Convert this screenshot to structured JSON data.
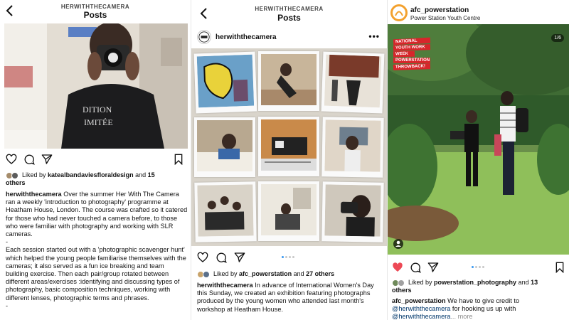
{
  "panel1": {
    "header_username": "HERWITHTHECAMERA",
    "header_title": "Posts",
    "likes": {
      "prefix": "Liked by",
      "name": "katealbandaviesfloraldesign",
      "and": "and",
      "count": "15",
      "suffix": "others"
    },
    "caption": {
      "username": "herwiththecamera",
      "text1": "Over the summer Her With The Camera ran a weekly 'introduction to photography' programme at Heatham House, London. The course was crafted so it catered for those who had never touched a camera before, to those who were familiar with photography and working with SLR cameras.",
      "dot": "-",
      "text2": "Each session started out with a 'photographic scavenger hunt' which helped the young people familiarise themselves with the cameras; it also served as a fun ice breaking and team building exercise. Then each pair/group rotated between different areas/exercises :identifying and discussing types of photography, basic composition techniques, working with different lenses, photographic terms and phrases.",
      "dot2": "-"
    }
  },
  "panel2": {
    "header_username": "HERWITHTHECAMERA",
    "header_title": "Posts",
    "account": "herwiththecamera",
    "likes": {
      "prefix": "Liked by",
      "name": "afc_powerstation",
      "and": "and",
      "count": "27 others"
    },
    "caption": {
      "username": "herwiththecamera",
      "text": "In advance of International Women's Day this Sunday, we created an exhibition featuring photographs produced by the young women who attended last month's workshop at Heatham House."
    }
  },
  "panel3": {
    "account": "afc_powerstation",
    "location": "Power Station Youth Centre",
    "carousel_count": "1/6",
    "sign_lines": [
      "NATIONAL",
      "YOUTH WORK",
      "WEEK",
      "POWERSTATION",
      "THROWBACK!"
    ],
    "likes": {
      "prefix": "Liked by",
      "name": "powerstation_photography",
      "and": "and",
      "count": "13",
      "suffix": "others"
    },
    "caption": {
      "username": "afc_powerstation",
      "text1": "We have to give credit to",
      "tag1": "@herwiththecamera",
      "text2": "for hooking us up with",
      "tag2": "@herwiththecamera",
      "more": "... more"
    }
  },
  "colors": {
    "like_red": "#ed4956",
    "link_blue": "#00376b",
    "dot_active": "#3897f0",
    "sign_red": "#d7262b"
  }
}
